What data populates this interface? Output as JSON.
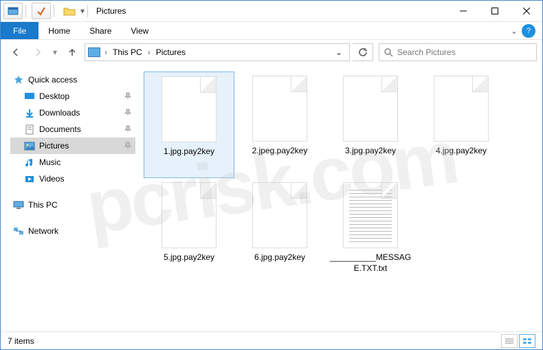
{
  "window": {
    "title": "Pictures"
  },
  "ribbon": {
    "file": "File",
    "tabs": [
      "Home",
      "Share",
      "View"
    ]
  },
  "breadcrumb": {
    "items": [
      "This PC",
      "Pictures"
    ]
  },
  "search": {
    "placeholder": "Search Pictures"
  },
  "nav": {
    "quick_access": "Quick access",
    "items": [
      {
        "label": "Desktop",
        "pinned": true
      },
      {
        "label": "Downloads",
        "pinned": true
      },
      {
        "label": "Documents",
        "pinned": true
      },
      {
        "label": "Pictures",
        "pinned": true,
        "selected": true
      },
      {
        "label": "Music",
        "pinned": false
      },
      {
        "label": "Videos",
        "pinned": false
      }
    ],
    "this_pc": "This PC",
    "network": "Network"
  },
  "files": [
    {
      "name": "1.jpg.pay2key",
      "type": "blank",
      "selected": true
    },
    {
      "name": "2.jpeg.pay2key",
      "type": "blank"
    },
    {
      "name": "3.jpg.pay2key",
      "type": "blank"
    },
    {
      "name": "4.jpg.pay2key",
      "type": "blank"
    },
    {
      "name": "5.jpg.pay2key",
      "type": "blank"
    },
    {
      "name": "6.jpg.pay2key",
      "type": "blank"
    },
    {
      "name": "__________MESSAGE.TXT.txt",
      "type": "txt"
    }
  ],
  "status": {
    "text": "7 items"
  },
  "watermark": "pcrisk.com"
}
